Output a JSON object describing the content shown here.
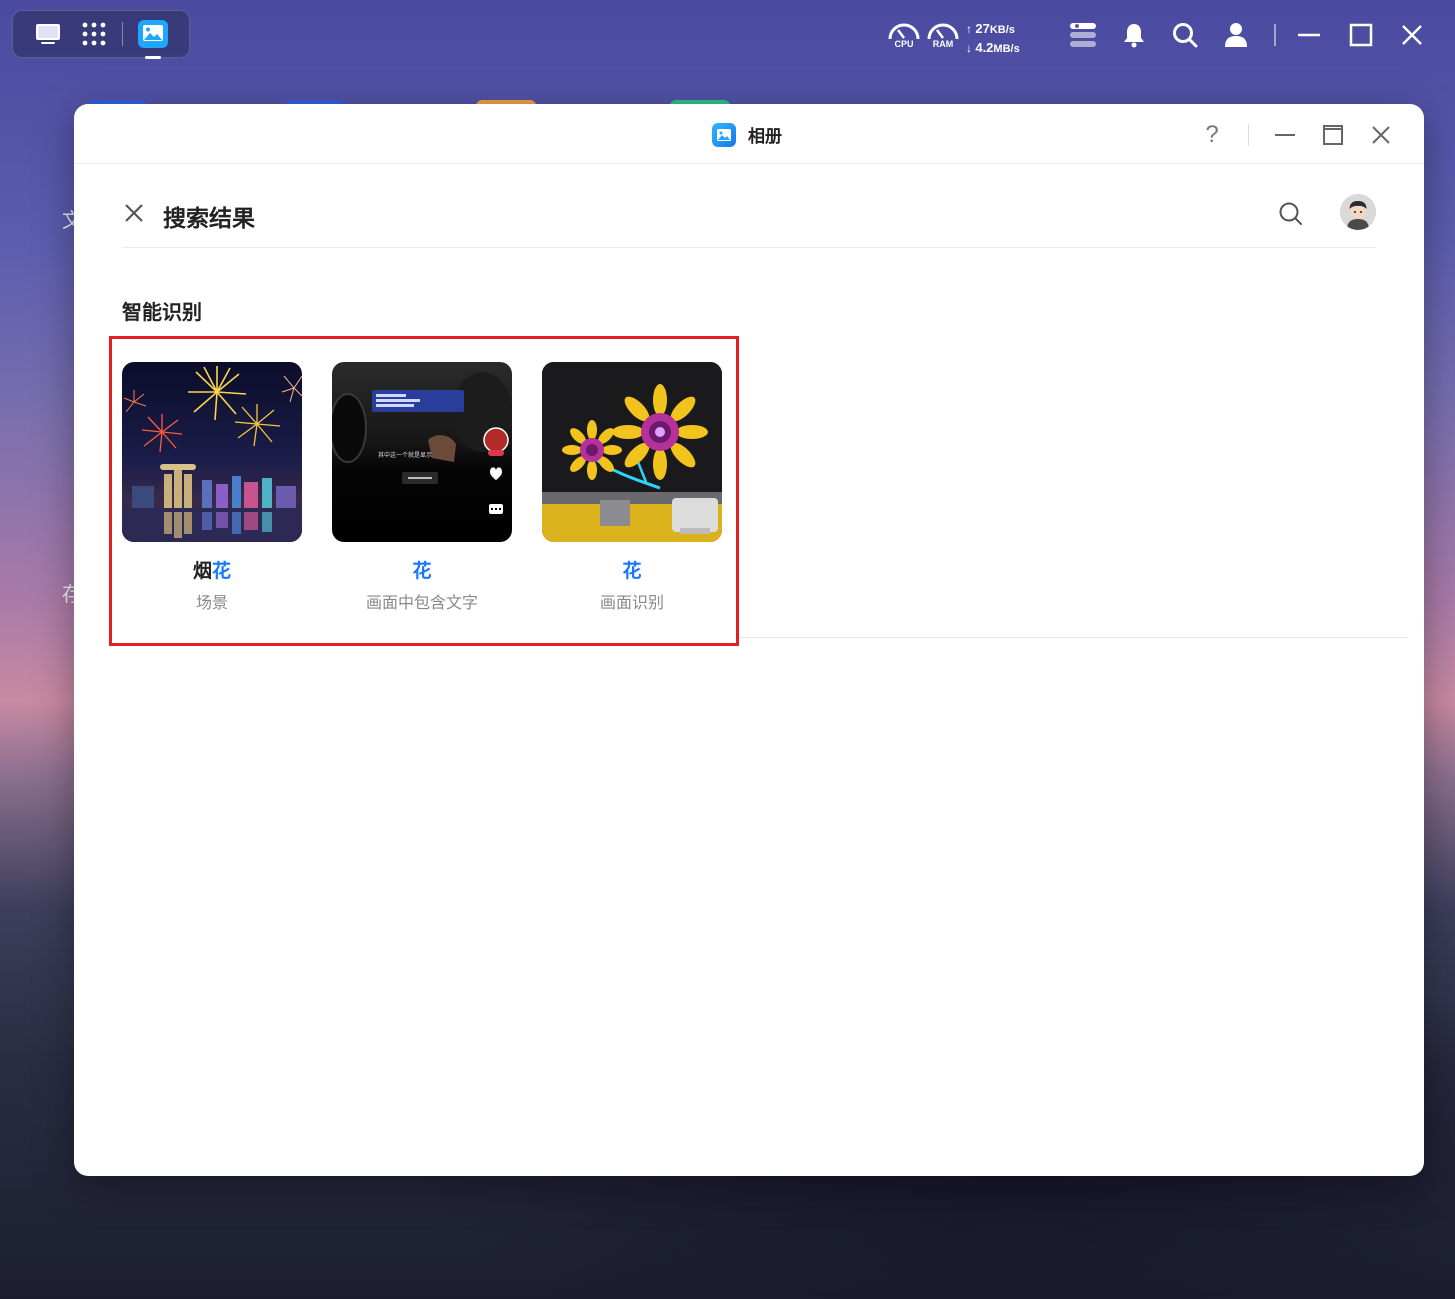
{
  "desktop": {
    "fragments": [
      "文",
      "存"
    ]
  },
  "topbar": {
    "cpu_label": "CPU",
    "ram_label": "RAM",
    "upload": "27",
    "upload_unit": "KB/s",
    "download": "4.2",
    "download_unit": "MB/s"
  },
  "window": {
    "title": "相册",
    "help": "?"
  },
  "header": {
    "title": "搜索结果"
  },
  "section": {
    "title": "智能识别"
  },
  "results": [
    {
      "title_plain": "烟",
      "title_highlight": "花",
      "subtitle": "场景",
      "thumbnail": "fireworks-photo"
    },
    {
      "title_plain": "",
      "title_highlight": "花",
      "subtitle": "画面中包含文字",
      "thumbnail": "video-screenshot"
    },
    {
      "title_plain": "",
      "title_highlight": "花",
      "subtitle": "画面识别",
      "thumbnail": "flower-monitor-photo"
    }
  ],
  "thumbnail_text": {
    "video_caption": "其中这一个就是显示"
  },
  "colors": {
    "highlight": "#1677ff",
    "selection_box": "#e31e24",
    "app_icon": "#1778e6"
  }
}
